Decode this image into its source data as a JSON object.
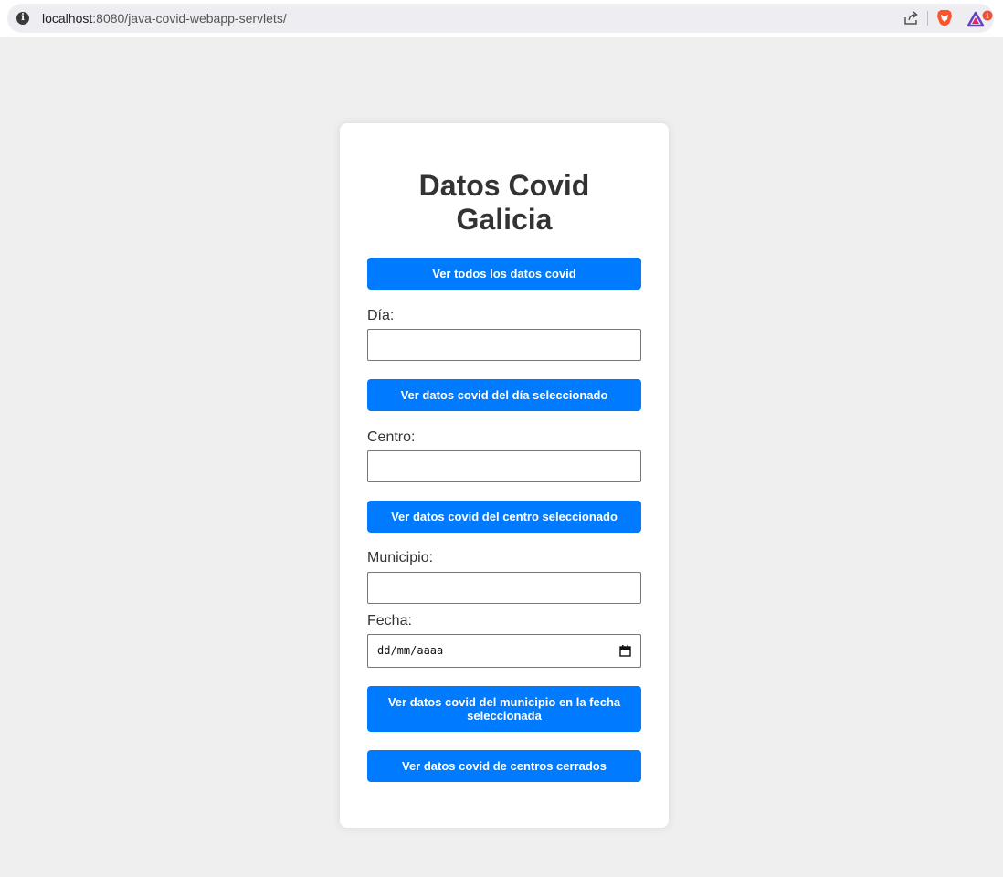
{
  "browser": {
    "url_host": "localhost",
    "url_rest": ":8080/java-covid-webapp-servlets/",
    "rewards_badge": "1"
  },
  "card": {
    "title_line1": "Datos Covid",
    "title_line2": "Galicia",
    "btn_all": "Ver todos los datos covid",
    "label_dia": "Día:",
    "btn_dia": "Ver datos covid del día seleccionado",
    "label_centro": "Centro:",
    "btn_centro": "Ver datos covid del centro seleccionado",
    "label_municipio": "Municipio:",
    "label_fecha": "Fecha:",
    "fecha_placeholder": "dd/mm/aaaa",
    "btn_municipio_fecha": "Ver datos covid del municipio en la fecha seleccionada",
    "btn_cerrados": "Ver datos covid de centros cerrados"
  },
  "colors": {
    "button": "#007bff",
    "page_bg": "#efefef",
    "card_bg": "#ffffff"
  }
}
